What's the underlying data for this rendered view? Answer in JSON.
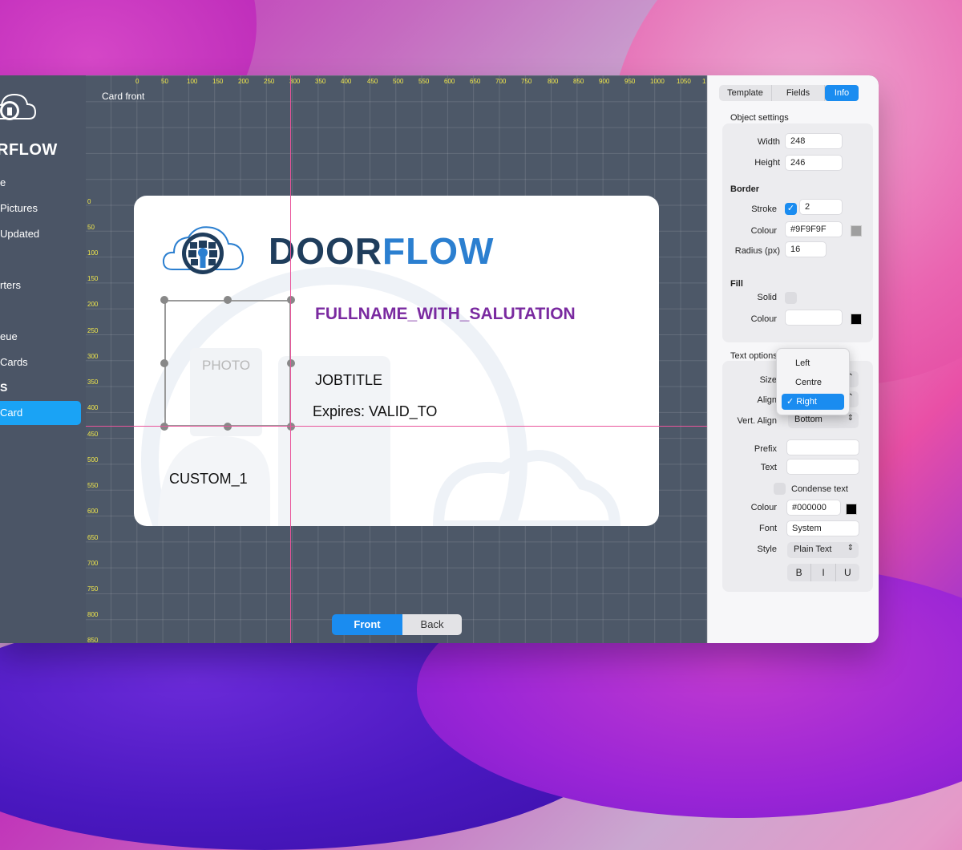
{
  "sidebar": {
    "brand": "RFLOW",
    "items": [
      {
        "label": "e"
      },
      {
        "label": "Pictures"
      },
      {
        "label": "Updated"
      },
      {
        "label": "rters"
      },
      {
        "label": "eue"
      },
      {
        "label": "Cards"
      }
    ],
    "heading": "S",
    "active_item": "Card"
  },
  "canvas": {
    "label": "Card front",
    "ruler_x": [
      "0",
      "50",
      "100",
      "150",
      "200",
      "250",
      "300",
      "350",
      "400",
      "450",
      "500",
      "550",
      "600",
      "650",
      "700",
      "750",
      "800",
      "850",
      "900",
      "950",
      "1000",
      "1050",
      "1"
    ],
    "ruler_y": [
      "0",
      "50",
      "100",
      "150",
      "200",
      "250",
      "300",
      "350",
      "400",
      "450",
      "500",
      "550",
      "600",
      "650",
      "700",
      "750",
      "800",
      "850"
    ]
  },
  "card": {
    "brand_dark": "DOOR",
    "brand_light": "FLOW",
    "fullname": "FULLNAME_WITH_SALUTATION",
    "jobtitle": "JOBTITLE",
    "expires": "Expires: VALID_TO",
    "custom": "CUSTOM_1",
    "photo": "PHOTO",
    "colors": {
      "fullname": "#7a2aa0",
      "brand_dark": "#1f3d5c",
      "brand_light": "#2b7fd0"
    }
  },
  "face_switch": {
    "front": "Front",
    "back": "Back"
  },
  "panel": {
    "tabs": [
      "Template",
      "Fields",
      "Info"
    ],
    "active_tab": "Info",
    "object_settings": {
      "title": "Object settings",
      "width_label": "Width",
      "width": "248",
      "height_label": "Height",
      "height": "246"
    },
    "border": {
      "title": "Border",
      "stroke_label": "Stroke",
      "stroke": "2",
      "colour_label": "Colour",
      "colour": "#9F9F9F",
      "radius_label": "Radius (px)",
      "radius": "16"
    },
    "fill": {
      "title": "Fill",
      "solid_label": "Solid",
      "colour_label": "Colour"
    },
    "text_options": {
      "title": "Text options",
      "size_label": "Size",
      "align_label": "Align",
      "vert_align_label": "Vert. Align",
      "vert_align": "Bottom",
      "prefix_label": "Prefix",
      "text_label": "Text",
      "condense_label": "Condense text",
      "colour_label": "Colour",
      "colour": "#000000",
      "font_label": "Font",
      "font": "System",
      "style_label": "Style",
      "style": "Plain Text",
      "bold": "B",
      "italic": "I",
      "underline": "U"
    },
    "align_dropdown": {
      "options": [
        "Left",
        "Centre",
        "✓ Right"
      ],
      "selected": "Right"
    }
  },
  "accent": "#1a8cf0"
}
